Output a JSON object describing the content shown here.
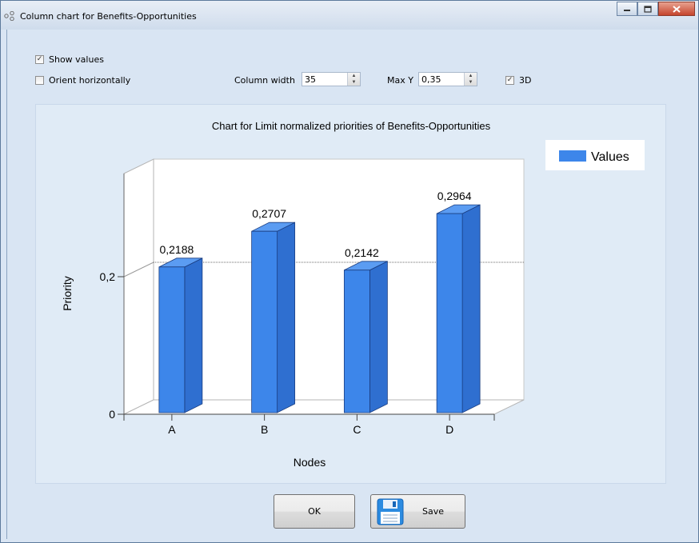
{
  "window": {
    "title": "Column chart for Benefits-Opportunities"
  },
  "controls": {
    "show_values": {
      "label": "Show values",
      "checked": true
    },
    "orient_horizontally": {
      "label": "Orient horizontally",
      "checked": false
    },
    "column_width": {
      "label": "Column width",
      "value": "35"
    },
    "max_y": {
      "label": "Max Y",
      "value": "0,35"
    },
    "three_d": {
      "label": "3D",
      "checked": true
    }
  },
  "buttons": {
    "ok": "OK",
    "save": "Save"
  },
  "colors": {
    "bar_front": "#3d86ea",
    "bar_side": "#2f6fd0",
    "bar_top": "#5b9cf2",
    "bar_edge": "#1a3d80"
  },
  "chart_data": {
    "type": "bar",
    "title": "Chart for Limit normalized priorities of Benefits-Opportunities",
    "xlabel": "Nodes",
    "ylabel": "Priority",
    "categories": [
      "A",
      "B",
      "C",
      "D"
    ],
    "series": [
      {
        "name": "Values",
        "values": [
          0.2188,
          0.2707,
          0.2142,
          0.2964
        ]
      }
    ],
    "value_labels": [
      "0,2188",
      "0,2707",
      "0,2142",
      "0,2964"
    ],
    "ytick_labels": [
      "0",
      "0,2"
    ],
    "yticks": [
      0,
      0.2
    ],
    "ylim": [
      0,
      0.35
    ],
    "grid": true,
    "three_d": true,
    "legend": "top-right"
  }
}
